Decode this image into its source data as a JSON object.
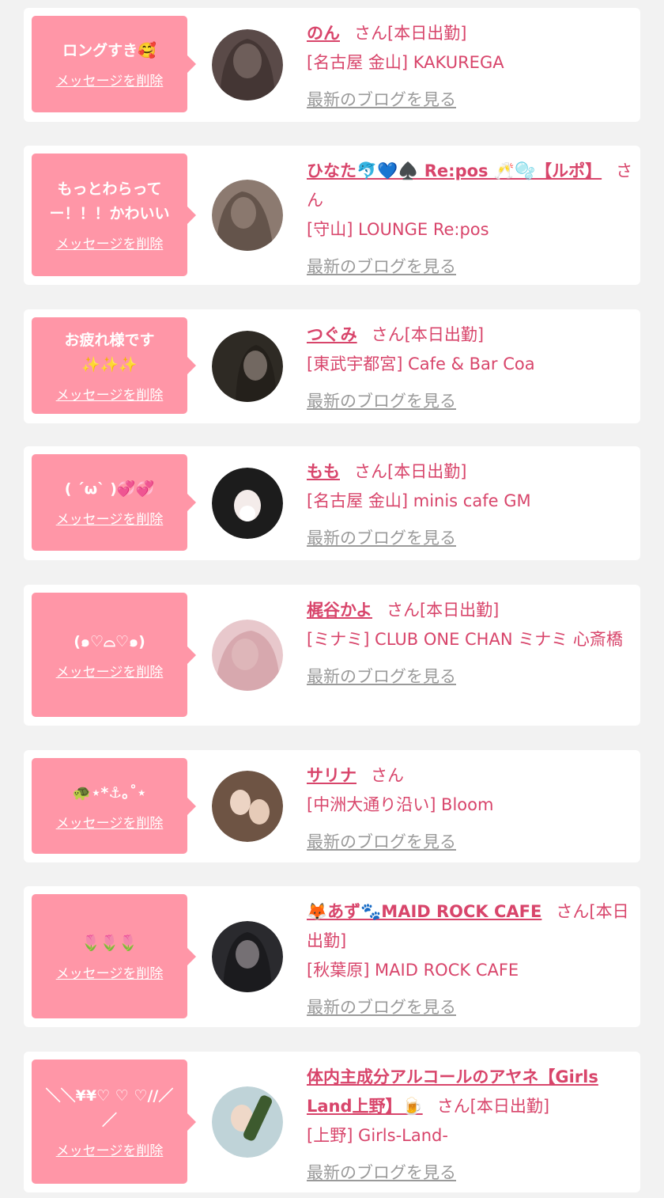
{
  "delete_label": "メッセージを削除",
  "blog_label": "最新のブログを見る",
  "san_label": "さん",
  "colors": {
    "bubble": "#ff96a7",
    "name": "#d8456b",
    "link_gray": "#9a9a9a",
    "background": "#f2f2f2"
  },
  "items": [
    {
      "message": "ロングすき🥰",
      "name": "のん",
      "suffix": "さん[本日出勤]",
      "shop": "[名古屋 金山] KAKUREGA"
    },
    {
      "message": "もっとわらってー！！！かわいい",
      "name": "ひなた🐬💙♠️ Re:pos 🥂🫧【ルポ】",
      "suffix": "さん",
      "shop": "[守山] LOUNGE Re:pos"
    },
    {
      "message": "お疲れ様です\n✨✨✨",
      "name": "つぐみ",
      "suffix": "さん[本日出勤]",
      "shop": "[東武宇都宮] Cafe & Bar Coa"
    },
    {
      "message": "( ´ω` )💞💞",
      "name": "もも",
      "suffix": "さん[本日出勤]",
      "shop": "[名古屋 金山] minis cafe GM"
    },
    {
      "message": "(๑♡⌓♡๑)",
      "name": "梶谷かよ",
      "suffix": "さん[本日出勤]",
      "shop": "[ミナミ] CLUB ONE CHAN ミナミ 心斎橋"
    },
    {
      "message": "🐢⋆*⚓︎｡˚⋆",
      "name": "サリナ",
      "suffix": "さん",
      "shop": "[中洲大通り沿い] Bloom"
    },
    {
      "message": "🌷🌷🌷",
      "name": "🦊あず🐾MAID ROCK CAFE",
      "suffix": "さん[本日出勤]",
      "shop": "[秋葉原] MAID ROCK CAFE"
    },
    {
      "message": "＼＼¥¥♡ ♡ ♡//／／",
      "name": "体内主成分アルコールのアヤネ【Girls Land上野】🍺",
      "suffix": "さん[本日出勤]",
      "shop": "[上野] Girls-Land-"
    }
  ]
}
